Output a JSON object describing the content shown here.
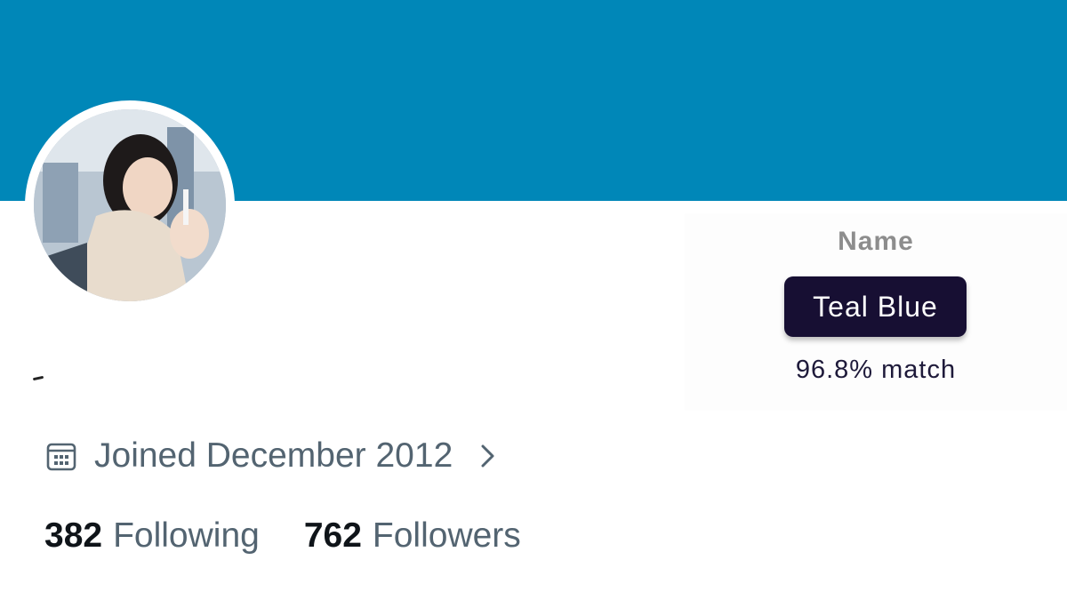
{
  "colors": {
    "banner": "#0087b8",
    "pill_bg": "#170f33",
    "secondary_text": "#536471"
  },
  "profile": {
    "avatar_alt": "profile photo",
    "joined_text": "Joined December 2012",
    "following_count": "382",
    "following_label": "Following",
    "followers_count": "762",
    "followers_label": "Followers"
  },
  "color_match": {
    "label": "Name",
    "color_name": "Teal Blue",
    "match_text": "96.8% match"
  },
  "icons": {
    "joined": "calendar-icon",
    "joined_arrow": "chevron-right-icon"
  }
}
